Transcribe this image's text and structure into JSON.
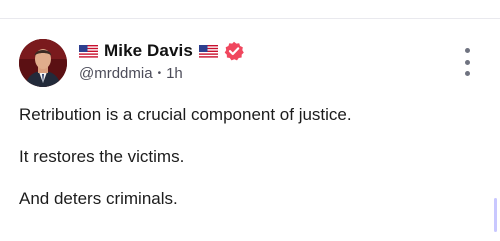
{
  "post": {
    "author": {
      "display_name": "Mike Davis",
      "handle": "@mrddmia",
      "flag_icon": "us-flag-icon",
      "verified_icon": "verified-badge-icon",
      "verified_color": "#f0475e"
    },
    "timestamp": "1h",
    "separator": "•",
    "paragraphs": [
      "Retribution is a crucial component of justice.",
      "It restores the victims.",
      "And deters criminals."
    ]
  },
  "colors": {
    "text": "#111111",
    "secondary": "#4d4d5a",
    "accent": "#f0475e",
    "scrollbar": "#c9c8ff"
  }
}
